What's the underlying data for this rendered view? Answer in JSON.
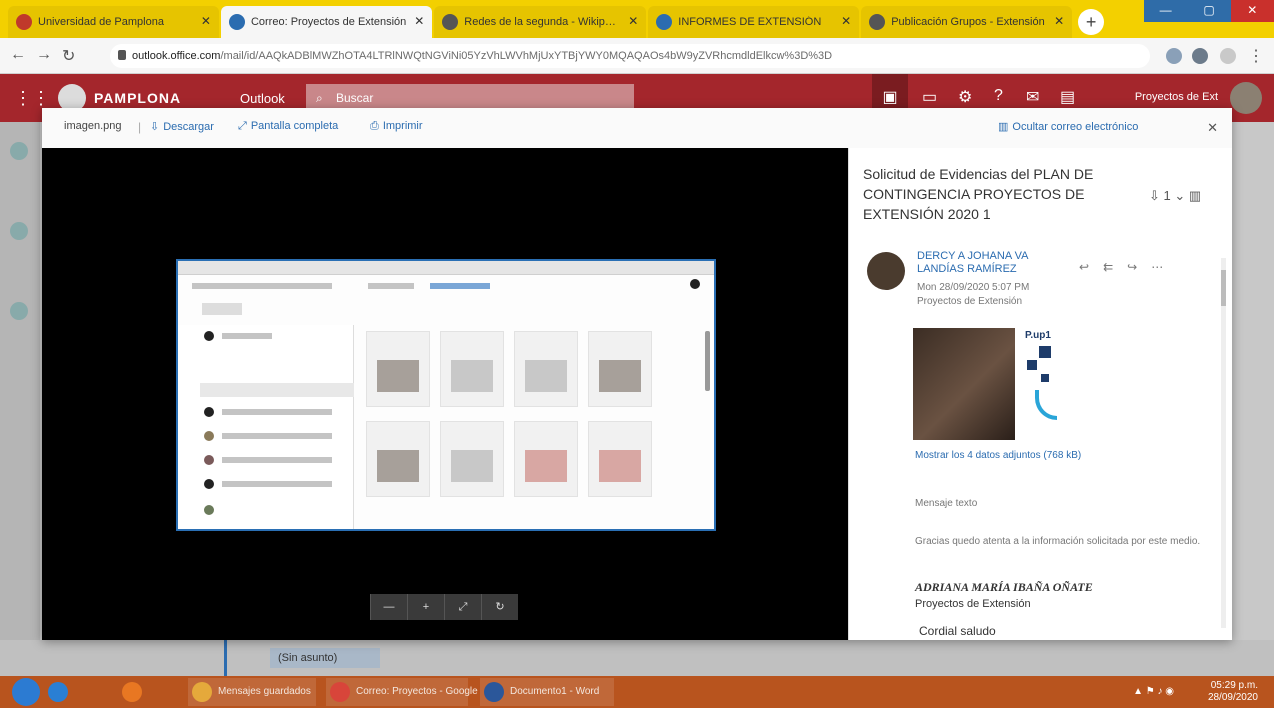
{
  "browser": {
    "tabs": [
      {
        "title": "Universidad de Pamplona",
        "favicon_color": "#c0392b"
      },
      {
        "title": "Correo: Proyectos de Extensión",
        "favicon_color": "#2b6cb0"
      },
      {
        "title": "Redes de la segunda - Wikipedia",
        "favicon_color": "#555555"
      },
      {
        "title": "INFORMES DE EXTENSIÓN",
        "favicon_color": "#2b6cb0"
      },
      {
        "title": "Publicación Grupos - Extensión",
        "favicon_color": "#555555"
      }
    ],
    "address": {
      "host": "outlook.office.com",
      "path": "/mail/id/AAQkADBlMWZhOTA4LTRlNWQtNGViNi05YzVhLWVhMjUxYTBjYWY0MQAQAOs4bW9yZVRhcmdldElkcw%3D%3D"
    }
  },
  "header": {
    "org_name": "PAMPLONA",
    "app_name": "Outlook",
    "search_placeholder": "Buscar",
    "user_name": "Proyectos de Ext"
  },
  "modal": {
    "toolbar": {
      "filename": "imagen.png",
      "download_label": "Descargar",
      "fullscreen_label": "Pantalla completa",
      "print_label": "Imprimir",
      "hide_history_label": "Ocultar correo electrónico"
    },
    "viewer": {
      "controls": [
        "—",
        "+",
        "⤢",
        "↻"
      ]
    },
    "reading_pane": {
      "subject": "Solicitud de Evidencias del PLAN DE CONTINGENCIA PROYECTOS DE EXTENSIÓN 2020 1",
      "subject_actions": "⇩ 1 ⌄ ▥",
      "sender": {
        "name": "DERCY A JOHANA VA LANDÍAS RAMÍREZ",
        "date": "Mon 28/09/2020 5:07 PM",
        "to": "Proyectos de Extensión"
      },
      "logo_text": "P.up1",
      "attachment_label": "Mostrar los 4 datos adjuntos (768 kB)",
      "body_lines": [
        "Mensaje texto",
        "Gracias quedo atenta a la información solicitada por este medio."
      ],
      "signature_name": "ADRIANA MARÍA IBAÑA OÑATE",
      "signature_role": "Proyectos de Extensión",
      "closing": "Cordial saludo"
    }
  },
  "bottom": {
    "draft_label": "(Sin asunto)"
  },
  "taskbar": {
    "apps": [
      {
        "label": "",
        "color": "#2a7fd4"
      },
      {
        "label": "",
        "color": "#e87722"
      },
      {
        "label": "Mensajes guardados",
        "color": "#e5a93b"
      },
      {
        "label": "Correo: Proyectos - Google",
        "color": "#d8453a"
      },
      {
        "label": "Documento1 - Word",
        "color": "#2b579a"
      }
    ],
    "clock_time": "05:29 p.m.",
    "clock_date": "28/09/2020"
  }
}
